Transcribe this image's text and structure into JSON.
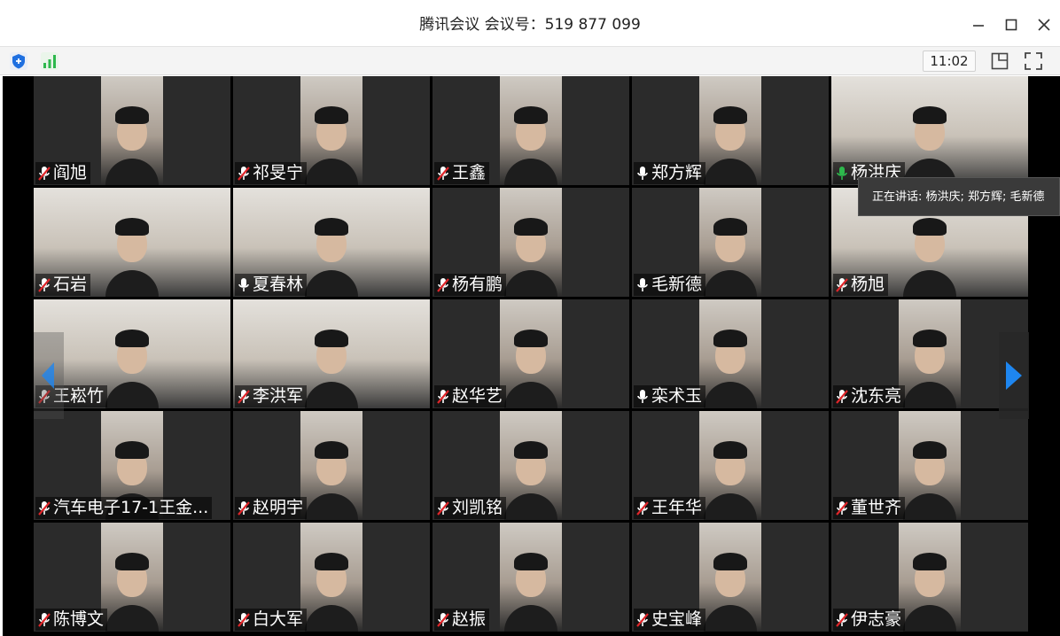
{
  "window": {
    "title": "腾讯会议 会议号：519 877 099"
  },
  "toolbar": {
    "clock": "11:02",
    "icons": [
      "shield-icon",
      "signal-icon",
      "layout-icon",
      "fullscreen-icon"
    ]
  },
  "speaking_tooltip": "正在讲话: 杨洪庆; 郑方辉; 毛新德",
  "colors": {
    "mic_muted": "#e0262a",
    "mic_active": "#2db84c",
    "accent_blue": "#1e86f0"
  },
  "participants": [
    {
      "name": "阎旭",
      "mic": "muted"
    },
    {
      "name": "祁旻宁",
      "mic": "muted"
    },
    {
      "name": "王鑫",
      "mic": "muted"
    },
    {
      "name": "郑方辉",
      "mic": "on"
    },
    {
      "name": "杨洪庆",
      "mic": "speaking"
    },
    {
      "name": "石岩",
      "mic": "muted"
    },
    {
      "name": "夏春林",
      "mic": "on"
    },
    {
      "name": "杨有鹏",
      "mic": "muted"
    },
    {
      "name": "毛新德",
      "mic": "on"
    },
    {
      "name": "杨旭",
      "mic": "muted"
    },
    {
      "name": "王崧竹",
      "mic": "muted"
    },
    {
      "name": "李洪军",
      "mic": "muted"
    },
    {
      "name": "赵华艺",
      "mic": "muted"
    },
    {
      "name": "栾术玉",
      "mic": "on"
    },
    {
      "name": "沈东亮",
      "mic": "muted"
    },
    {
      "name": "汽车电子17-1王金...",
      "mic": "muted"
    },
    {
      "name": "赵明宇",
      "mic": "muted"
    },
    {
      "name": "刘凯铭",
      "mic": "muted"
    },
    {
      "name": "王年华",
      "mic": "muted"
    },
    {
      "name": "董世齐",
      "mic": "muted"
    },
    {
      "name": "陈博文",
      "mic": "muted"
    },
    {
      "name": "白大军",
      "mic": "muted"
    },
    {
      "name": "赵振",
      "mic": "muted"
    },
    {
      "name": "史宝峰",
      "mic": "muted"
    },
    {
      "name": "伊志豪",
      "mic": "muted"
    }
  ]
}
